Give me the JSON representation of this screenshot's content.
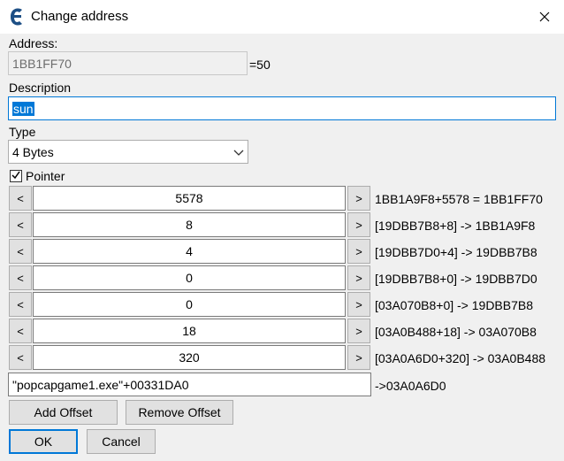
{
  "window": {
    "title": "Change address",
    "app_icon": "cheat-engine-icon",
    "close_icon": "close-icon"
  },
  "address": {
    "label": "Address:",
    "value": "1BB1FF70",
    "suffix": "=50"
  },
  "description": {
    "label": "Description",
    "value": "sun"
  },
  "type": {
    "label": "Type",
    "selected": "4 Bytes"
  },
  "pointer": {
    "label": "Pointer",
    "checked": true
  },
  "offsets": [
    {
      "value": "5578",
      "dec": "<",
      "inc": ">",
      "result": "1BB1A9F8+5578 = 1BB1FF70"
    },
    {
      "value": "8",
      "dec": "<",
      "inc": ">",
      "result": "[19DBB7B8+8] -> 1BB1A9F8"
    },
    {
      "value": "4",
      "dec": "<",
      "inc": ">",
      "result": "[19DBB7D0+4] -> 19DBB7B8"
    },
    {
      "value": "0",
      "dec": "<",
      "inc": ">",
      "result": "[19DBB7B8+0] -> 19DBB7D0"
    },
    {
      "value": "0",
      "dec": "<",
      "inc": ">",
      "result": "[03A070B8+0] -> 19DBB7B8"
    },
    {
      "value": "18",
      "dec": "<",
      "inc": ">",
      "result": "[03A0B488+18] -> 03A070B8"
    },
    {
      "value": "320",
      "dec": "<",
      "inc": ">",
      "result": "[03A0A6D0+320] -> 03A0B488"
    }
  ],
  "base": {
    "value": "\"popcapgame1.exe\"+00331DA0",
    "result": "->03A0A6D0"
  },
  "buttons": {
    "add_offset": "Add Offset",
    "remove_offset": "Remove Offset",
    "ok": "OK",
    "cancel": "Cancel"
  },
  "colors": {
    "accent": "#0078d7",
    "app_icon": "#2b6fb3"
  }
}
